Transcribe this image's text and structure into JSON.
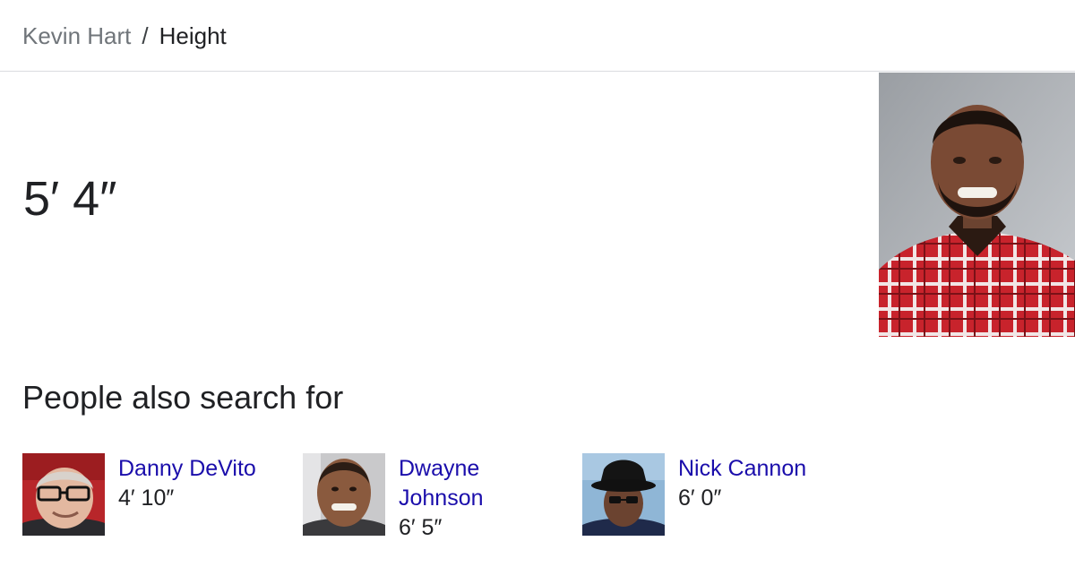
{
  "breadcrumb": {
    "parent": "Kevin Hart",
    "separator": "/",
    "current": "Height"
  },
  "answer": {
    "value": "5′ 4″"
  },
  "main_image": {
    "icon": "person-photo"
  },
  "people_also_search": {
    "title": "People also search for",
    "items": [
      {
        "name": "Danny DeVito",
        "height": "4′ 10″"
      },
      {
        "name": "Dwayne Johnson",
        "height": "6′ 5″"
      },
      {
        "name": "Nick Cannon",
        "height": "6′ 0″"
      }
    ]
  },
  "colors": {
    "link": "#1a0dab",
    "text": "#202124",
    "muted": "#70757a",
    "divider": "#dadce0"
  }
}
